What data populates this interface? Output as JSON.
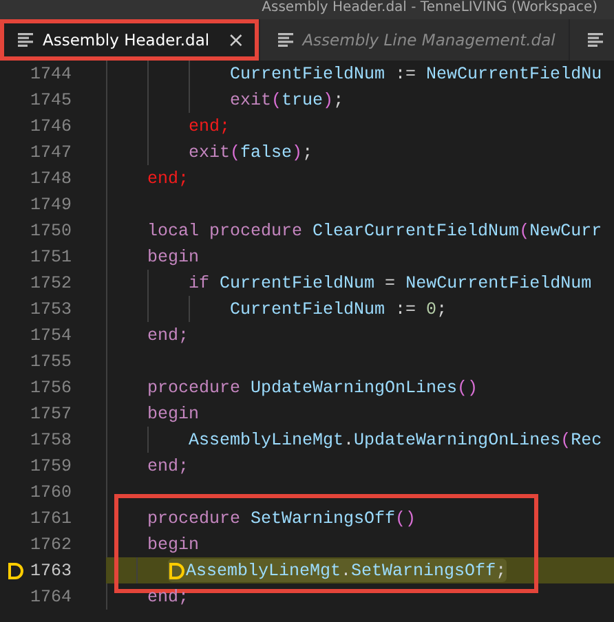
{
  "window": {
    "title": "Assembly Header.dal - TenneLIVING (Workspace)"
  },
  "tabs": [
    {
      "label": "Assembly Header.dal",
      "selected": true,
      "framed": true,
      "close": "×"
    },
    {
      "label": "Assembly Line Management.dal",
      "selected": false,
      "framed": false
    },
    {
      "selected": false,
      "framed": false
    }
  ],
  "lines": [
    {
      "number": "1744",
      "current": false,
      "framed": false,
      "tokens": [
        {
          "kind": "id",
          "text": "            CurrentFieldNum"
        },
        {
          "kind": "op",
          "text": " := "
        },
        {
          "kind": "id",
          "text": "NewCurrentFieldNu"
        }
      ]
    },
    {
      "number": "1745",
      "current": false,
      "framed": false,
      "tokens": [
        {
          "kind": "kw",
          "text": "            exit"
        },
        {
          "kind": "br",
          "text": "("
        },
        {
          "kind": "id",
          "text": "true"
        },
        {
          "kind": "br",
          "text": ")"
        },
        {
          "kind": "plain",
          "text": ";"
        }
      ]
    },
    {
      "number": "1746",
      "current": false,
      "framed": false,
      "tokens": [
        {
          "kind": "err",
          "text": "        end;"
        }
      ]
    },
    {
      "number": "1747",
      "current": false,
      "framed": false,
      "tokens": [
        {
          "kind": "kw",
          "text": "        exit"
        },
        {
          "kind": "br",
          "text": "("
        },
        {
          "kind": "id",
          "text": "false"
        },
        {
          "kind": "br",
          "text": ")"
        },
        {
          "kind": "plain",
          "text": ";"
        }
      ]
    },
    {
      "number": "1748",
      "current": false,
      "framed": false,
      "tokens": [
        {
          "kind": "err",
          "text": "    end;"
        }
      ]
    },
    {
      "number": "1749",
      "current": false,
      "framed": false
    },
    {
      "number": "1750",
      "current": false,
      "framed": false,
      "tokens": [
        {
          "kind": "kw",
          "text": "    local procedure "
        },
        {
          "kind": "id",
          "text": "ClearCurrentFieldNum"
        },
        {
          "kind": "br",
          "text": "("
        },
        {
          "kind": "id",
          "text": "NewCurr"
        }
      ]
    },
    {
      "number": "1751",
      "current": false,
      "framed": false,
      "tokens": [
        {
          "kind": "kw",
          "text": "    begin"
        }
      ]
    },
    {
      "number": "1752",
      "current": false,
      "framed": false,
      "tokens": [
        {
          "kind": "kw",
          "text": "        if "
        },
        {
          "kind": "id",
          "text": "CurrentFieldNum"
        },
        {
          "kind": "op",
          "text": " = "
        },
        {
          "kind": "id",
          "text": "NewCurrentFieldNum"
        }
      ]
    },
    {
      "number": "1753",
      "current": false,
      "framed": false,
      "tokens": [
        {
          "kind": "id",
          "text": "            CurrentFieldNum"
        },
        {
          "kind": "op",
          "text": " := "
        },
        {
          "kind": "num",
          "text": "0"
        },
        {
          "kind": "plain",
          "text": ";"
        }
      ]
    },
    {
      "number": "1754",
      "current": false,
      "framed": false,
      "tokens": [
        {
          "kind": "kw",
          "text": "    end;"
        }
      ]
    },
    {
      "number": "1755",
      "current": false,
      "framed": false
    },
    {
      "number": "1756",
      "current": false,
      "framed": false,
      "tokens": [
        {
          "kind": "kw",
          "text": "    procedure "
        },
        {
          "kind": "id",
          "text": "UpdateWarningOnLines"
        },
        {
          "kind": "br",
          "text": "()"
        }
      ]
    },
    {
      "number": "1757",
      "current": false,
      "framed": false,
      "tokens": [
        {
          "kind": "kw",
          "text": "    begin"
        }
      ]
    },
    {
      "number": "1758",
      "current": false,
      "framed": false,
      "tokens": [
        {
          "kind": "id",
          "text": "        AssemblyLineMgt"
        },
        {
          "kind": "plain",
          "text": "."
        },
        {
          "kind": "id",
          "text": "UpdateWarningOnLines"
        },
        {
          "kind": "br",
          "text": "("
        },
        {
          "kind": "id",
          "text": "Rec"
        }
      ]
    },
    {
      "number": "1759",
      "current": false,
      "framed": false,
      "tokens": [
        {
          "kind": "kw",
          "text": "    end;"
        }
      ]
    },
    {
      "number": "1760",
      "current": false,
      "framed": false
    },
    {
      "number": "1761",
      "current": false,
      "framed": true,
      "tokens": [
        {
          "kind": "kw",
          "text": "    procedure "
        },
        {
          "kind": "id",
          "text": "SetWarningsOff"
        },
        {
          "kind": "br",
          "text": "()"
        }
      ]
    },
    {
      "number": "1762",
      "current": false,
      "framed": true,
      "tokens": [
        {
          "kind": "kw",
          "text": "    begin"
        }
      ]
    },
    {
      "number": "1763",
      "current": true,
      "framed": true,
      "tokens": [
        {
          "kind": "id",
          "text": "        AssemblyLineMgt"
        },
        {
          "kind": "plain",
          "text": "."
        },
        {
          "kind": "id",
          "text": "SetWarningsOff"
        },
        {
          "kind": "plain",
          "text": ";"
        }
      ]
    },
    {
      "number": "1764",
      "current": false,
      "framed": false,
      "tokens": [
        {
          "kind": "kw",
          "text": "    end;"
        }
      ]
    }
  ]
}
